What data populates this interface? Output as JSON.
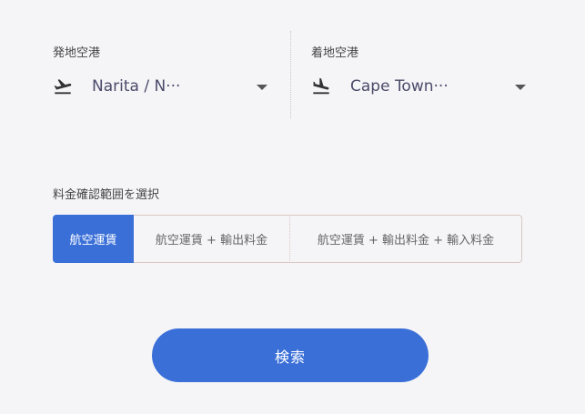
{
  "departure": {
    "label": "発地空港",
    "value": "Narita / N···",
    "icon": "plane-departure-icon"
  },
  "arrival": {
    "label": "着地空港",
    "value": "Cape Town···",
    "icon": "plane-arrival-icon"
  },
  "fare_range": {
    "label": "料金確認範囲を選択",
    "options": [
      "航空運賃",
      "航空運賃 + 輸出料金",
      "航空運賃 + 輸出料金 + 輸入料金"
    ],
    "selected": "航空運賃"
  },
  "search": {
    "label": "検索"
  },
  "colors": {
    "accent": "#3a6fd8",
    "background": "#f5f4f7"
  }
}
